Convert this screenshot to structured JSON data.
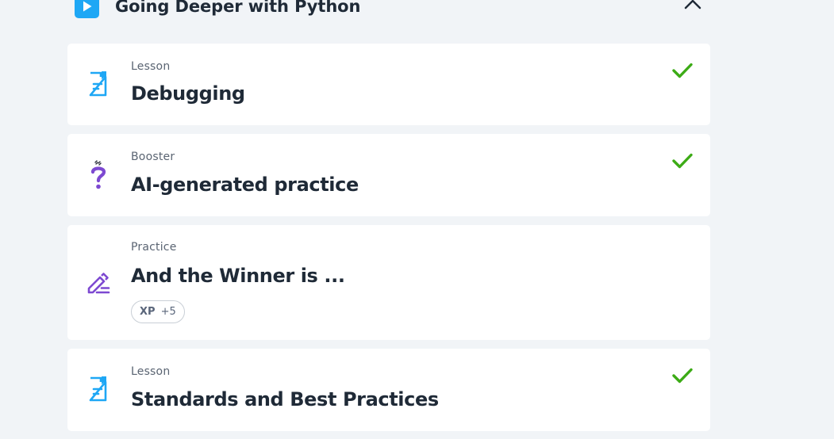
{
  "section": {
    "title": "Going Deeper with Python",
    "icon": "play-icon",
    "collapse_icon": "chevron-up-icon",
    "accent": "#1ea7f5"
  },
  "items": [
    {
      "type": "Lesson",
      "title": "Debugging",
      "icon": "lesson-document-icon",
      "completed": true
    },
    {
      "type": "Booster",
      "title": "AI-generated practice",
      "icon": "question-mark-sparkle-icon",
      "completed": true
    },
    {
      "type": "Practice",
      "title": "And the Winner is ...",
      "icon": "pencil-edit-icon",
      "completed": false,
      "xp_label": "XP",
      "xp_value": "+5"
    },
    {
      "type": "Lesson",
      "title": "Standards and Best Practices",
      "icon": "lesson-document-icon",
      "completed": true
    }
  ],
  "colors": {
    "check": "#3cab16",
    "lesson_icon": "#1ea7f5",
    "practice_icon": "#7d49d1",
    "background": "#f1f4f7"
  }
}
